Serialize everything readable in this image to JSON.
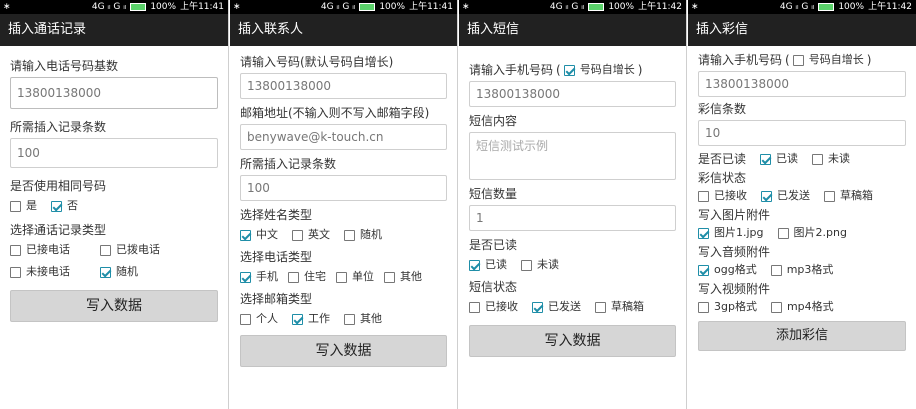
{
  "status_bar": [
    {
      "left": "∗",
      "signal": "4G ᵢₗ G ᵢₗ",
      "battery": "100%",
      "time": "上午11:41"
    },
    {
      "left": "∗",
      "signal": "4G ᵢₗ G ᵢₗ",
      "battery": "100%",
      "time": "上午11:41"
    },
    {
      "left": "∗",
      "signal": "4G ᵢₗ G ᵢₗ",
      "battery": "100%",
      "time": "上午11:42"
    },
    {
      "left": "∗",
      "signal": "4G ᵢₗ G ᵢₗ",
      "battery": "100%",
      "time": "上午11:42"
    }
  ],
  "call_log": {
    "title": "插入通话记录",
    "base_number_label": "请输入电话号码基数",
    "base_number_value": "13800138000",
    "count_label": "所需插入记录条数",
    "count_value": "100",
    "same_number_label": "是否使用相同号码",
    "same_yes": "是",
    "same_no": "否",
    "type_label": "选择通话记录类型",
    "type_received": "已接电话",
    "type_dialed": "已拨电话",
    "type_missed": "未接电话",
    "type_random": "随机",
    "submit": "写入数据"
  },
  "contacts": {
    "title": "插入联系人",
    "phone_label": "请输入号码(默认号码自增长)",
    "phone_value": "13800138000",
    "email_label": "邮箱地址(不输入则不写入邮箱字段)",
    "email_value": "benywave@k-touch.cn",
    "count_label": "所需插入记录条数",
    "count_value": "100",
    "name_type_label": "选择姓名类型",
    "name_cn": "中文",
    "name_en": "英文",
    "name_random": "随机",
    "phone_type_label": "选择电话类型",
    "phone_mobile": "手机",
    "phone_home": "住宅",
    "phone_work": "单位",
    "phone_other": "其他",
    "email_type_label": "选择邮箱类型",
    "email_personal": "个人",
    "email_work": "工作",
    "email_other": "其他",
    "submit": "写入数据"
  },
  "sms": {
    "title": "插入短信",
    "phone_label": "请输入手机号码",
    "auto_increment": "号码自增长",
    "phone_value": "13800138000",
    "content_label": "短信内容",
    "content_placeholder": "短信测试示例",
    "count_label": "短信数量",
    "count_value": "1",
    "read_label": "是否已读",
    "read_yes": "已读",
    "read_no": "未读",
    "state_label": "短信状态",
    "state_received": "已接收",
    "state_sent": "已发送",
    "state_draft": "草稿箱",
    "submit": "写入数据"
  },
  "mms": {
    "title": "插入彩信",
    "phone_label": "请输入手机号码",
    "auto_increment": "号码自增长",
    "phone_value": "13800138000",
    "count_label": "彩信条数",
    "count_value": "10",
    "read_label": "是否已读",
    "read_yes": "已读",
    "read_no": "未读",
    "state_label": "彩信状态",
    "state_received": "已接收",
    "state_sent": "已发送",
    "state_draft": "草稿箱",
    "image_label": "写入图片附件",
    "image_1": "图片1.jpg",
    "image_2": "图片2.png",
    "audio_label": "写入音频附件",
    "audio_ogg": "ogg格式",
    "audio_mp3": "mp3格式",
    "video_label": "写入视频附件",
    "video_3gp": "3gp格式",
    "video_mp4": "mp4格式",
    "submit": "添加彩信"
  },
  "colors": {
    "accent": "#1f8ea8",
    "titlebar": "#212121",
    "button": "#d6d6d6"
  }
}
